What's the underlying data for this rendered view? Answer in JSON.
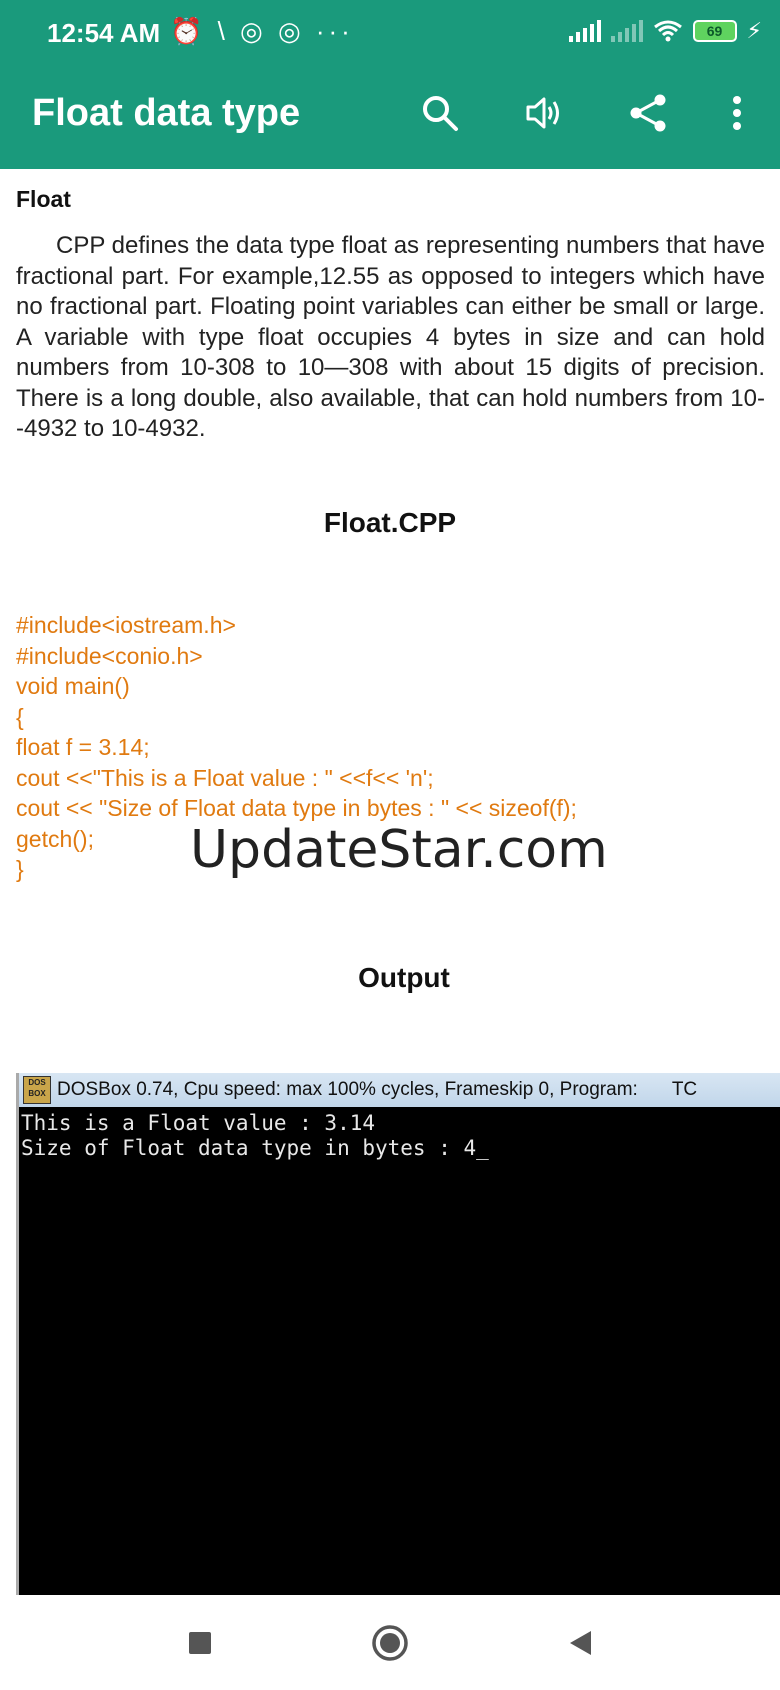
{
  "status_bar": {
    "time": "12:54 AM",
    "left_icons": "⏰ \\ ◎ ◎ ···",
    "battery": "69"
  },
  "app_bar": {
    "title": "Float data type",
    "actions": [
      "search-icon",
      "speaker-icon",
      "share-icon",
      "more-vert-icon"
    ],
    "color": "#1a9a7c"
  },
  "content": {
    "heading": "Float",
    "paragraph": "CPP defines the data type float as representing numbers that have fractional part. For example,12.55 as opposed to integers which have no fractional part. Floating point variables can either be small or large. A variable with type float occupies 4 bytes in size and can hold numbers from 10-308 to 10—308 with about 15 digits of precision. There is a long double, also available, that can hold numbers from 10--4932 to 10-4932.",
    "code_title": "Float.CPP",
    "code_lines": [
      "#include<iostream.h>",
      "#include<conio.h>",
      "void main()",
      "{",
      "float f = 3.14;",
      "cout <<\"This is a Float value : \" <<f<< 'n';",
      "cout << \"Size of Float data type in bytes : \" << sizeof(f);",
      "getch();",
      "}"
    ],
    "code_color": "#e07a10",
    "watermark": "UpdateStar.com",
    "output_title": "Output"
  },
  "dosbox": {
    "logo": "DOS BOX",
    "title": "DOSBox 0.74, Cpu speed: max 100% cycles, Frameskip  0, Program:",
    "program": "TC",
    "lines": [
      "This is a Float value : 3.14",
      "Size of Float data type in bytes : 4_"
    ]
  },
  "nav_bar": {
    "buttons": [
      "recents-square-icon",
      "home-circle-icon",
      "back-triangle-icon"
    ]
  }
}
